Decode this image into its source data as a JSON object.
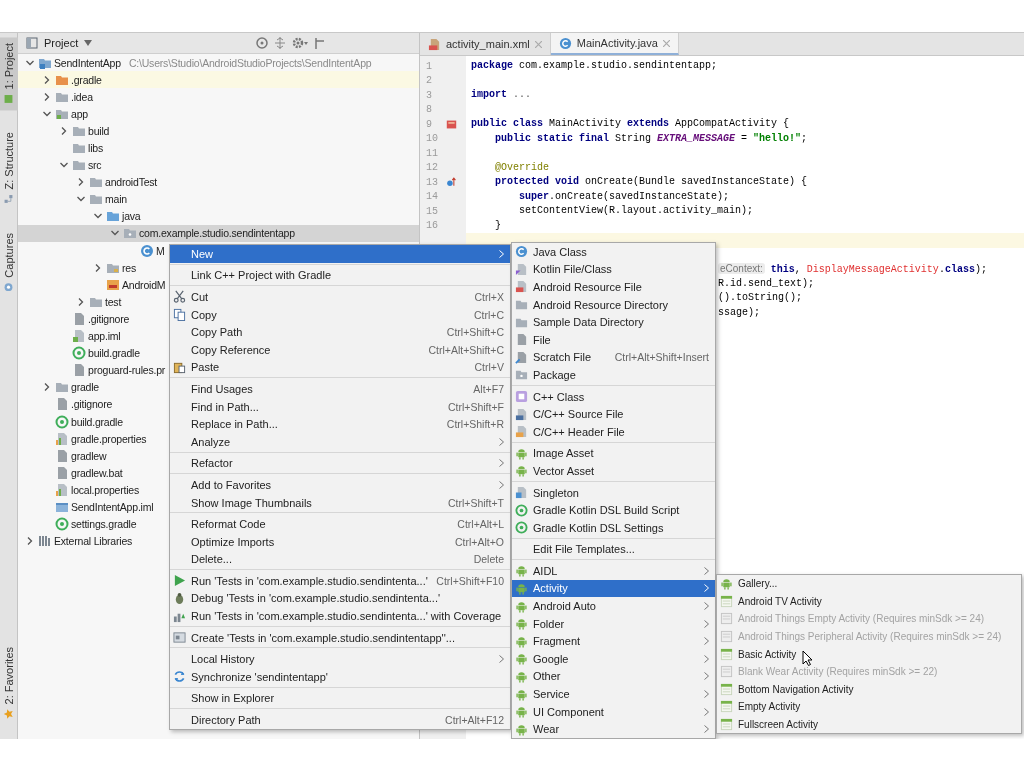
{
  "sidebar": {
    "tabs": [
      {
        "label": "1: Project",
        "selected": true
      },
      {
        "label": "Z: Structure",
        "selected": false
      },
      {
        "label": "Captures",
        "selected": false
      }
    ],
    "bottom_tabs": [
      {
        "label": "2: Favorites",
        "selected": false
      }
    ]
  },
  "project": {
    "title": "Project",
    "tree": [
      {
        "label": "SendIntentApp",
        "path": "C:\\Users\\Studio\\AndroidStudioProjects\\SendIntentApp",
        "kind": "module",
        "expanded": true,
        "selected": false,
        "children": [
          {
            "label": ".gradle",
            "kind": "excluded",
            "expanded": false,
            "selected": false
          },
          {
            "label": ".idea",
            "kind": "folder",
            "expanded": false,
            "selected": false
          },
          {
            "label": "app",
            "kind": "module-folder",
            "expanded": true,
            "selected": false,
            "children": [
              {
                "label": "build",
                "kind": "folder",
                "expanded": false,
                "selected": false
              },
              {
                "label": "libs",
                "kind": "folder",
                "selected": false
              },
              {
                "label": "src",
                "kind": "folder",
                "expanded": true,
                "selected": false,
                "children": [
                  {
                    "label": "androidTest",
                    "kind": "folder",
                    "expanded": false,
                    "selected": false
                  },
                  {
                    "label": "main",
                    "kind": "folder",
                    "expanded": true,
                    "selected": false,
                    "children": [
                      {
                        "label": "java",
                        "kind": "source-folder",
                        "expanded": true,
                        "selected": false,
                        "children": [
                          {
                            "label": "com.example.studio.sendintentapp",
                            "kind": "package",
                            "expanded": true,
                            "selected": true,
                            "children": [
                              {
                                "label": "M",
                                "kind": "class",
                                "selected": false
                              }
                            ]
                          }
                        ]
                      },
                      {
                        "label": "res",
                        "kind": "res-folder",
                        "expanded": false,
                        "selected": false
                      },
                      {
                        "label": "AndroidM",
                        "kind": "manifest",
                        "selected": false
                      }
                    ]
                  },
                  {
                    "label": "test",
                    "kind": "folder",
                    "expanded": false,
                    "selected": false
                  }
                ]
              },
              {
                "label": ".gitignore",
                "kind": "file",
                "selected": false
              },
              {
                "label": "app.iml",
                "kind": "iml",
                "selected": false
              },
              {
                "label": "build.gradle",
                "kind": "gradle",
                "selected": false
              },
              {
                "label": "proguard-rules.pr",
                "kind": "file",
                "selected": false
              }
            ]
          },
          {
            "label": "gradle",
            "kind": "folder",
            "expanded": false,
            "selected": false
          },
          {
            "label": ".gitignore",
            "kind": "file",
            "selected": false
          },
          {
            "label": "build.gradle",
            "kind": "gradle",
            "selected": false
          },
          {
            "label": "gradle.properties",
            "kind": "props",
            "selected": false
          },
          {
            "label": "gradlew",
            "kind": "file",
            "selected": false
          },
          {
            "label": "gradlew.bat",
            "kind": "file",
            "selected": false
          },
          {
            "label": "local.properties",
            "kind": "props",
            "selected": false
          },
          {
            "label": "SendIntentApp.iml",
            "kind": "module-file",
            "selected": false
          },
          {
            "label": "settings.gradle",
            "kind": "gradle",
            "selected": false
          }
        ]
      },
      {
        "label": "External Libraries",
        "kind": "library",
        "expanded": false,
        "selected": false
      }
    ]
  },
  "editor": {
    "tabs": [
      {
        "label": "activity_main.xml",
        "kind": "xml",
        "selected": false
      },
      {
        "label": "MainActivity.java",
        "kind": "class",
        "selected": true
      }
    ],
    "lines": [
      {
        "kind": "line",
        "number": "1",
        "current": false,
        "tokens": [
          {
            "kind": "kw",
            "text": "package"
          },
          {
            "kind": "pl",
            "text": " com.example.studio.sendintentapp;"
          }
        ]
      },
      {
        "kind": "line",
        "number": "2",
        "current": false
      },
      {
        "kind": "line",
        "number": "3",
        "current": false,
        "tokens": [
          {
            "kind": "kw",
            "text": "import"
          },
          {
            "kind": "fold",
            "text": " ..."
          }
        ]
      },
      {
        "kind": "line",
        "number": "8",
        "current": false
      },
      {
        "kind": "layout-marked",
        "number": "9",
        "current": false,
        "tokens": [
          {
            "kind": "kw",
            "text": "public class"
          },
          {
            "kind": "pl",
            "text": " MainActivity "
          },
          {
            "kind": "kw",
            "text": "extends"
          },
          {
            "kind": "pl",
            "text": " AppCompatActivity {"
          }
        ]
      },
      {
        "kind": "line",
        "number": "10",
        "current": false,
        "tokens": [
          {
            "kind": "kw",
            "text": "    public static final"
          },
          {
            "kind": "pl",
            "text": " String "
          },
          {
            "kind": "field",
            "text": "EXTRA_MESSAGE"
          },
          {
            "kind": "pl",
            "text": " = "
          },
          {
            "kind": "str",
            "text": "\"hello!\""
          },
          {
            "kind": "pl",
            "text": ";"
          }
        ]
      },
      {
        "kind": "line",
        "number": "11",
        "current": false
      },
      {
        "kind": "line",
        "number": "12",
        "current": false,
        "tokens": [
          {
            "kind": "anno",
            "text": "    @Override"
          }
        ]
      },
      {
        "kind": "override-marked",
        "number": "13",
        "current": false,
        "tokens": [
          {
            "kind": "kw",
            "text": "    protected void"
          },
          {
            "kind": "pl",
            "text": " onCreate(Bundle savedInstanceState) {"
          }
        ]
      },
      {
        "kind": "line",
        "number": "14",
        "current": false,
        "tokens": [
          {
            "kind": "kw",
            "text": "        super"
          },
          {
            "kind": "pl",
            "text": ".onCreate(savedInstanceState);"
          }
        ]
      },
      {
        "kind": "line",
        "number": "15",
        "current": false,
        "tokens": [
          {
            "kind": "pl",
            "text": "        setContentView(R.layout.activity_main);"
          }
        ]
      },
      {
        "kind": "line",
        "number": "16",
        "current": false,
        "tokens": [
          {
            "kind": "pl",
            "text": "    }"
          }
        ]
      },
      {
        "kind": "partial",
        "current": true
      },
      {
        "kind": "partial",
        "current": false
      },
      {
        "kind": "partial",
        "current": false,
        "tokens": [
          {
            "kind": "hint",
            "text": "eContext:"
          },
          {
            "kind": "kw",
            "text": " this"
          },
          {
            "kind": "pl",
            "text": ", "
          },
          {
            "kind": "err",
            "text": "DisplayMessageActivity"
          },
          {
            "kind": "pl",
            "text": "."
          },
          {
            "kind": "kw",
            "text": "class"
          },
          {
            "kind": "pl",
            "text": ");"
          }
        ]
      },
      {
        "kind": "partial",
        "current": false,
        "tokens": [
          {
            "kind": "pl",
            "text": "R.id.send_text);"
          }
        ]
      },
      {
        "kind": "partial",
        "current": false,
        "tokens": [
          {
            "kind": "pl",
            "text": "().toString();"
          }
        ]
      },
      {
        "kind": "partial",
        "current": false,
        "tokens": [
          {
            "kind": "pl",
            "text": "ssage);"
          }
        ]
      }
    ]
  },
  "context_menu": {
    "items": [
      {
        "kind": "plain",
        "label": "New",
        "submenu": true,
        "selected": true
      },
      {
        "kind": "separator"
      },
      {
        "kind": "plain",
        "label": "Link C++ Project with Gradle",
        "submenu": false,
        "selected": false
      },
      {
        "kind": "separator"
      },
      {
        "kind": "scissors",
        "label": "Cut",
        "shortcut": "Ctrl+X",
        "submenu": false,
        "selected": false
      },
      {
        "kind": "documents",
        "label": "Copy",
        "shortcut": "Ctrl+C",
        "submenu": false,
        "selected": false
      },
      {
        "kind": "plain",
        "label": "Copy Path",
        "shortcut": "Ctrl+Shift+C",
        "submenu": false,
        "selected": false
      },
      {
        "kind": "plain",
        "label": "Copy Reference",
        "shortcut": "Ctrl+Alt+Shift+C",
        "submenu": false,
        "selected": false
      },
      {
        "kind": "clipboard",
        "label": "Paste",
        "shortcut": "Ctrl+V",
        "submenu": false,
        "selected": false
      },
      {
        "kind": "separator"
      },
      {
        "kind": "plain",
        "label": "Find Usages",
        "shortcut": "Alt+F7",
        "submenu": false,
        "selected": false
      },
      {
        "kind": "plain",
        "label": "Find in Path...",
        "shortcut": "Ctrl+Shift+F",
        "submenu": false,
        "selected": false
      },
      {
        "kind": "plain",
        "label": "Replace in Path...",
        "shortcut": "Ctrl+Shift+R",
        "submenu": false,
        "selected": false
      },
      {
        "kind": "plain",
        "label": "Analyze",
        "submenu": true,
        "selected": false
      },
      {
        "kind": "separator"
      },
      {
        "kind": "plain",
        "label": "Refactor",
        "submenu": true,
        "selected": false
      },
      {
        "kind": "separator"
      },
      {
        "kind": "plain",
        "label": "Add to Favorites",
        "submenu": true,
        "selected": false
      },
      {
        "kind": "plain",
        "label": "Show Image Thumbnails",
        "shortcut": "Ctrl+Shift+T",
        "submenu": false,
        "selected": false
      },
      {
        "kind": "separator"
      },
      {
        "kind": "plain",
        "label": "Reformat Code",
        "shortcut": "Ctrl+Alt+L",
        "submenu": false,
        "selected": false
      },
      {
        "kind": "plain",
        "label": "Optimize Imports",
        "shortcut": "Ctrl+Alt+O",
        "submenu": false,
        "selected": false
      },
      {
        "kind": "plain",
        "label": "Delete...",
        "shortcut": "Delete",
        "submenu": false,
        "selected": false
      },
      {
        "kind": "separator"
      },
      {
        "kind": "play",
        "label": "Run 'Tests in 'com.example.studio.sendintenta...'",
        "shortcut": "Ctrl+Shift+F10",
        "submenu": false,
        "selected": false
      },
      {
        "kind": "bug",
        "label": "Debug 'Tests in 'com.example.studio.sendintenta...'",
        "submenu": false,
        "selected": false
      },
      {
        "kind": "coverage",
        "label": "Run 'Tests in 'com.example.studio.sendintenta...' with Coverage",
        "submenu": false,
        "selected": false
      },
      {
        "kind": "separator"
      },
      {
        "kind": "test-file",
        "label": "Create 'Tests in 'com.example.studio.sendintentapp''...",
        "submenu": false,
        "selected": false
      },
      {
        "kind": "separator"
      },
      {
        "kind": "plain",
        "label": "Local History",
        "submenu": true,
        "selected": false
      },
      {
        "kind": "sync",
        "label": "Synchronize 'sendintentapp'",
        "submenu": false,
        "selected": false
      },
      {
        "kind": "separator"
      },
      {
        "kind": "plain",
        "label": "Show in Explorer",
        "submenu": false,
        "selected": false
      },
      {
        "kind": "separator"
      },
      {
        "kind": "plain",
        "label": "Directory Path",
        "shortcut": "Ctrl+Alt+F12",
        "submenu": false,
        "selected": false
      }
    ]
  },
  "new_submenu": {
    "items": [
      {
        "kind": "class",
        "label": "Java Class",
        "submenu": false,
        "selected": false
      },
      {
        "kind": "kotlin-file",
        "label": "Kotlin File/Class",
        "submenu": false,
        "selected": false
      },
      {
        "kind": "resource-file",
        "label": "Android Resource File",
        "submenu": false,
        "selected": false
      },
      {
        "kind": "folder",
        "label": "Android Resource Directory",
        "submenu": false,
        "selected": false
      },
      {
        "kind": "folder",
        "label": "Sample Data Directory",
        "submenu": false,
        "selected": false
      },
      {
        "kind": "file",
        "label": "File",
        "submenu": false,
        "selected": false
      },
      {
        "kind": "scratch-file",
        "label": "Scratch File",
        "shortcut": "Ctrl+Alt+Shift+Insert",
        "submenu": false,
        "selected": false
      },
      {
        "kind": "package",
        "label": "Package",
        "submenu": false,
        "selected": false
      },
      {
        "kind": "separator"
      },
      {
        "kind": "cpp-class",
        "label": "C++ Class",
        "submenu": false,
        "selected": false
      },
      {
        "kind": "cpp-file",
        "label": "C/C++ Source File",
        "submenu": false,
        "selected": false
      },
      {
        "kind": "cpp-header",
        "label": "C/C++ Header File",
        "submenu": false,
        "selected": false
      },
      {
        "kind": "separator"
      },
      {
        "kind": "android",
        "label": "Image Asset",
        "submenu": false,
        "selected": false
      },
      {
        "kind": "android",
        "label": "Vector Asset",
        "submenu": false,
        "selected": false
      },
      {
        "kind": "separator"
      },
      {
        "kind": "singleton",
        "label": "Singleton",
        "submenu": false,
        "selected": false
      },
      {
        "kind": "gradle",
        "label": "Gradle Kotlin DSL Build Script",
        "submenu": false,
        "selected": false
      },
      {
        "kind": "gradle",
        "label": "Gradle Kotlin DSL Settings",
        "submenu": false,
        "selected": false
      },
      {
        "kind": "separator"
      },
      {
        "kind": "plain",
        "label": "Edit File Templates...",
        "submenu": false,
        "selected": false
      },
      {
        "kind": "separator"
      },
      {
        "kind": "android",
        "label": "AIDL",
        "submenu": true,
        "selected": false
      },
      {
        "kind": "android",
        "label": "Activity",
        "submenu": true,
        "selected": true
      },
      {
        "kind": "android",
        "label": "Android Auto",
        "submenu": true,
        "selected": false
      },
      {
        "kind": "android",
        "label": "Folder",
        "submenu": true,
        "selected": false
      },
      {
        "kind": "android",
        "label": "Fragment",
        "submenu": true,
        "selected": false
      },
      {
        "kind": "android",
        "label": "Google",
        "submenu": true,
        "selected": false
      },
      {
        "kind": "android",
        "label": "Other",
        "submenu": true,
        "selected": false
      },
      {
        "kind": "android",
        "label": "Service",
        "submenu": true,
        "selected": false
      },
      {
        "kind": "android",
        "label": "UI Component",
        "submenu": true,
        "selected": false
      },
      {
        "kind": "android",
        "label": "Wear",
        "submenu": true,
        "selected": false
      }
    ]
  },
  "activity_submenu": {
    "items": [
      {
        "kind": "android",
        "label": "Gallery...",
        "disabled": false,
        "hovered": false,
        "selected": false
      },
      {
        "kind": "layout",
        "label": "Android TV Activity",
        "disabled": false,
        "hovered": false,
        "selected": false
      },
      {
        "kind": "layout",
        "label": "Android Things Empty Activity (Requires minSdk >= 24)",
        "disabled": true,
        "hovered": false,
        "selected": false
      },
      {
        "kind": "layout",
        "label": "Android Things Peripheral Activity (Requires minSdk >= 24)",
        "disabled": true,
        "hovered": false,
        "selected": false
      },
      {
        "kind": "layout",
        "label": "Basic Activity",
        "disabled": false,
        "hovered": true,
        "selected": false
      },
      {
        "kind": "layout",
        "label": "Blank Wear Activity (Requires minSdk >= 22)",
        "disabled": true,
        "hovered": false,
        "selected": false
      },
      {
        "kind": "layout",
        "label": "Bottom Navigation Activity",
        "disabled": false,
        "hovered": false,
        "selected": false
      },
      {
        "kind": "layout",
        "label": "Empty Activity",
        "disabled": false,
        "hovered": false,
        "selected": false
      },
      {
        "kind": "layout",
        "label": "Fullscreen Activity",
        "disabled": false,
        "hovered": false,
        "selected": false
      }
    ]
  }
}
